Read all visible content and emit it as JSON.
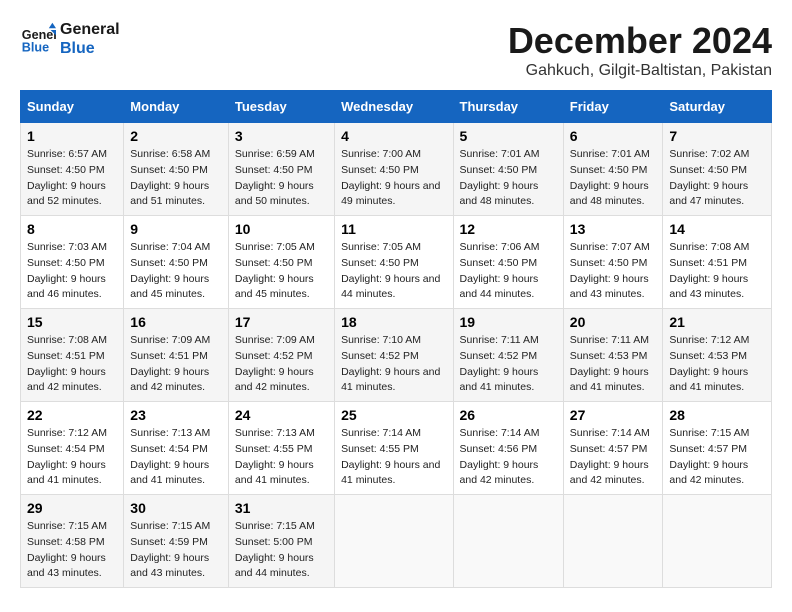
{
  "logo": {
    "line1": "General",
    "line2": "Blue"
  },
  "title": "December 2024",
  "location": "Gahkuch, Gilgit-Baltistan, Pakistan",
  "weekdays": [
    "Sunday",
    "Monday",
    "Tuesday",
    "Wednesday",
    "Thursday",
    "Friday",
    "Saturday"
  ],
  "weeks": [
    [
      {
        "day": "1",
        "sunrise": "Sunrise: 6:57 AM",
        "sunset": "Sunset: 4:50 PM",
        "daylight": "Daylight: 9 hours and 52 minutes."
      },
      {
        "day": "2",
        "sunrise": "Sunrise: 6:58 AM",
        "sunset": "Sunset: 4:50 PM",
        "daylight": "Daylight: 9 hours and 51 minutes."
      },
      {
        "day": "3",
        "sunrise": "Sunrise: 6:59 AM",
        "sunset": "Sunset: 4:50 PM",
        "daylight": "Daylight: 9 hours and 50 minutes."
      },
      {
        "day": "4",
        "sunrise": "Sunrise: 7:00 AM",
        "sunset": "Sunset: 4:50 PM",
        "daylight": "Daylight: 9 hours and 49 minutes."
      },
      {
        "day": "5",
        "sunrise": "Sunrise: 7:01 AM",
        "sunset": "Sunset: 4:50 PM",
        "daylight": "Daylight: 9 hours and 48 minutes."
      },
      {
        "day": "6",
        "sunrise": "Sunrise: 7:01 AM",
        "sunset": "Sunset: 4:50 PM",
        "daylight": "Daylight: 9 hours and 48 minutes."
      },
      {
        "day": "7",
        "sunrise": "Sunrise: 7:02 AM",
        "sunset": "Sunset: 4:50 PM",
        "daylight": "Daylight: 9 hours and 47 minutes."
      }
    ],
    [
      {
        "day": "8",
        "sunrise": "Sunrise: 7:03 AM",
        "sunset": "Sunset: 4:50 PM",
        "daylight": "Daylight: 9 hours and 46 minutes."
      },
      {
        "day": "9",
        "sunrise": "Sunrise: 7:04 AM",
        "sunset": "Sunset: 4:50 PM",
        "daylight": "Daylight: 9 hours and 45 minutes."
      },
      {
        "day": "10",
        "sunrise": "Sunrise: 7:05 AM",
        "sunset": "Sunset: 4:50 PM",
        "daylight": "Daylight: 9 hours and 45 minutes."
      },
      {
        "day": "11",
        "sunrise": "Sunrise: 7:05 AM",
        "sunset": "Sunset: 4:50 PM",
        "daylight": "Daylight: 9 hours and 44 minutes."
      },
      {
        "day": "12",
        "sunrise": "Sunrise: 7:06 AM",
        "sunset": "Sunset: 4:50 PM",
        "daylight": "Daylight: 9 hours and 44 minutes."
      },
      {
        "day": "13",
        "sunrise": "Sunrise: 7:07 AM",
        "sunset": "Sunset: 4:50 PM",
        "daylight": "Daylight: 9 hours and 43 minutes."
      },
      {
        "day": "14",
        "sunrise": "Sunrise: 7:08 AM",
        "sunset": "Sunset: 4:51 PM",
        "daylight": "Daylight: 9 hours and 43 minutes."
      }
    ],
    [
      {
        "day": "15",
        "sunrise": "Sunrise: 7:08 AM",
        "sunset": "Sunset: 4:51 PM",
        "daylight": "Daylight: 9 hours and 42 minutes."
      },
      {
        "day": "16",
        "sunrise": "Sunrise: 7:09 AM",
        "sunset": "Sunset: 4:51 PM",
        "daylight": "Daylight: 9 hours and 42 minutes."
      },
      {
        "day": "17",
        "sunrise": "Sunrise: 7:09 AM",
        "sunset": "Sunset: 4:52 PM",
        "daylight": "Daylight: 9 hours and 42 minutes."
      },
      {
        "day": "18",
        "sunrise": "Sunrise: 7:10 AM",
        "sunset": "Sunset: 4:52 PM",
        "daylight": "Daylight: 9 hours and 41 minutes."
      },
      {
        "day": "19",
        "sunrise": "Sunrise: 7:11 AM",
        "sunset": "Sunset: 4:52 PM",
        "daylight": "Daylight: 9 hours and 41 minutes."
      },
      {
        "day": "20",
        "sunrise": "Sunrise: 7:11 AM",
        "sunset": "Sunset: 4:53 PM",
        "daylight": "Daylight: 9 hours and 41 minutes."
      },
      {
        "day": "21",
        "sunrise": "Sunrise: 7:12 AM",
        "sunset": "Sunset: 4:53 PM",
        "daylight": "Daylight: 9 hours and 41 minutes."
      }
    ],
    [
      {
        "day": "22",
        "sunrise": "Sunrise: 7:12 AM",
        "sunset": "Sunset: 4:54 PM",
        "daylight": "Daylight: 9 hours and 41 minutes."
      },
      {
        "day": "23",
        "sunrise": "Sunrise: 7:13 AM",
        "sunset": "Sunset: 4:54 PM",
        "daylight": "Daylight: 9 hours and 41 minutes."
      },
      {
        "day": "24",
        "sunrise": "Sunrise: 7:13 AM",
        "sunset": "Sunset: 4:55 PM",
        "daylight": "Daylight: 9 hours and 41 minutes."
      },
      {
        "day": "25",
        "sunrise": "Sunrise: 7:14 AM",
        "sunset": "Sunset: 4:55 PM",
        "daylight": "Daylight: 9 hours and 41 minutes."
      },
      {
        "day": "26",
        "sunrise": "Sunrise: 7:14 AM",
        "sunset": "Sunset: 4:56 PM",
        "daylight": "Daylight: 9 hours and 42 minutes."
      },
      {
        "day": "27",
        "sunrise": "Sunrise: 7:14 AM",
        "sunset": "Sunset: 4:57 PM",
        "daylight": "Daylight: 9 hours and 42 minutes."
      },
      {
        "day": "28",
        "sunrise": "Sunrise: 7:15 AM",
        "sunset": "Sunset: 4:57 PM",
        "daylight": "Daylight: 9 hours and 42 minutes."
      }
    ],
    [
      {
        "day": "29",
        "sunrise": "Sunrise: 7:15 AM",
        "sunset": "Sunset: 4:58 PM",
        "daylight": "Daylight: 9 hours and 43 minutes."
      },
      {
        "day": "30",
        "sunrise": "Sunrise: 7:15 AM",
        "sunset": "Sunset: 4:59 PM",
        "daylight": "Daylight: 9 hours and 43 minutes."
      },
      {
        "day": "31",
        "sunrise": "Sunrise: 7:15 AM",
        "sunset": "Sunset: 5:00 PM",
        "daylight": "Daylight: 9 hours and 44 minutes."
      },
      null,
      null,
      null,
      null
    ]
  ]
}
